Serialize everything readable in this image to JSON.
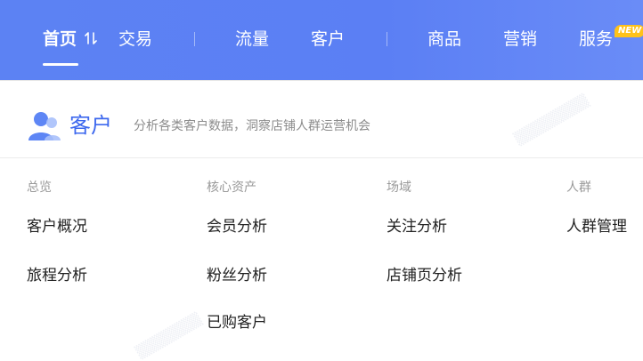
{
  "nav": {
    "items": [
      {
        "label": "首页",
        "active": true
      },
      {
        "label": "交易"
      },
      {
        "label": "流量"
      },
      {
        "label": "客户"
      },
      {
        "label": "商品"
      },
      {
        "label": "营销"
      },
      {
        "label": "服务",
        "badge": "NEW"
      }
    ]
  },
  "panel": {
    "title": "客户",
    "description": "分析各类客户数据，洞察店铺人群运营机会",
    "columns": [
      {
        "heading": "总览",
        "links": [
          "客户概况",
          "旅程分析"
        ]
      },
      {
        "heading": "核心资产",
        "links": [
          "会员分析",
          "粉丝分析",
          "已购客户"
        ]
      },
      {
        "heading": "场域",
        "links": [
          "关注分析",
          "店铺页分析"
        ]
      },
      {
        "heading": "人群",
        "links": [
          "人群管理"
        ]
      }
    ]
  },
  "colors": {
    "nav_bg": "#5c82f3",
    "accent": "#3d68ee",
    "badge": "#ffc21a"
  }
}
